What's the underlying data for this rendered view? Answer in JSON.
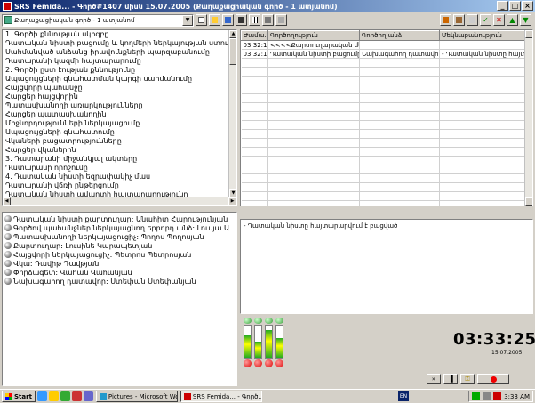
{
  "window": {
    "title": "SRS Femida... - Գործ#1407 միսն 15.07.2005 (Քաղաքացիական գործ - 1 ատյանոմ)",
    "controls": [
      "_",
      "□",
      "×"
    ]
  },
  "toolbar": {
    "case_type_selected": "Քաղաքացիական գործ - 1 ատյանոմ"
  },
  "agenda": {
    "items": [
      "1. Գործի քննության սկիզբը",
      "Դատական նիստի բացումը և կողմերի ներկայության ստուգումը",
      "Սահմանված անձանց իրավունքների պարզաբանումը",
      "Դատարանի կազմի հայտարարումը",
      "2. Գործի ըստ էության քննությունը",
      "Ապացույցների գնահատման կարգի սահմանումը",
      "Հայցվորի պահանջը",
      "Հարցեր հայցվորին",
      "Պատասխանողի առարկությունները",
      "Հարցեր պատասխանողին",
      "Միջնորդությունների ներկայացումը",
      "Ապացույցների գնահատումը",
      "Վկաների բացատրությունները",
      "Հարցեր վկաներին",
      "3. Դատարանի միջանկյալ ակտերը",
      "Դատարանի որոշումը",
      "4. Դատական նիստի եզրափակիչ մաս",
      "Դատարանի վճռի ընթերցումը",
      "Դատական նիստի ավարտի հայտարարությունը"
    ]
  },
  "speakers": {
    "items": [
      "Դատական նիստի քարտուղար: Անահիտ Հարությունյան",
      "Գործով պահանջներ ներկայացնող երրորդ անձ: Լուսյա Ա",
      "Պատասխանողի ներկայացուցիչ: Պողոս Պողոսյան",
      "Քարտուղար: Լուսինե Կարապետյան",
      "Հայցվորի ներկայացուցիչ: Պետրոս Պետրոսյան",
      "Վկա: Դավիթ Դավթյան",
      "Փորձագետ: Վահան Վահանյան",
      "Նախագահող դատավոր: Ստեփան Ստեփանյան"
    ]
  },
  "log": {
    "columns": [
      "Ժամա...",
      "Գործողություն",
      "Գործող անձ",
      "Մեկնաբանություն"
    ],
    "rows": [
      [
        "03:32:14",
        "<<<<Քարտուղարական մեկնաբանություն>>>",
        "",
        ""
      ],
      [
        "03:32:18",
        "Դատական նիստի բացումը...",
        "Նախագահող դատավոր...",
        "- Դատական նիստը հայտարարվում է..."
      ]
    ],
    "empty_rows": 17
  },
  "note": {
    "text": "- Դատական նիստը հայտարարվում է բացված"
  },
  "meters": {
    "levels": [
      0.7,
      0.5,
      0.85,
      0.6
    ]
  },
  "clock": {
    "time": "03:33:25",
    "date": "15.07.2005"
  },
  "taskbar": {
    "start_label": "Start",
    "tasks": [
      {
        "label": "Pictures - Microsoft Word",
        "active": false
      },
      {
        "label": "SRS Femida... - Գործ...",
        "active": true
      }
    ],
    "lang": "EN",
    "time": "3:33 AM"
  },
  "colors": {
    "title_start": "#0a246a",
    "title_end": "#a6caf0",
    "record": "#e00000",
    "meter": "#22aa22"
  }
}
